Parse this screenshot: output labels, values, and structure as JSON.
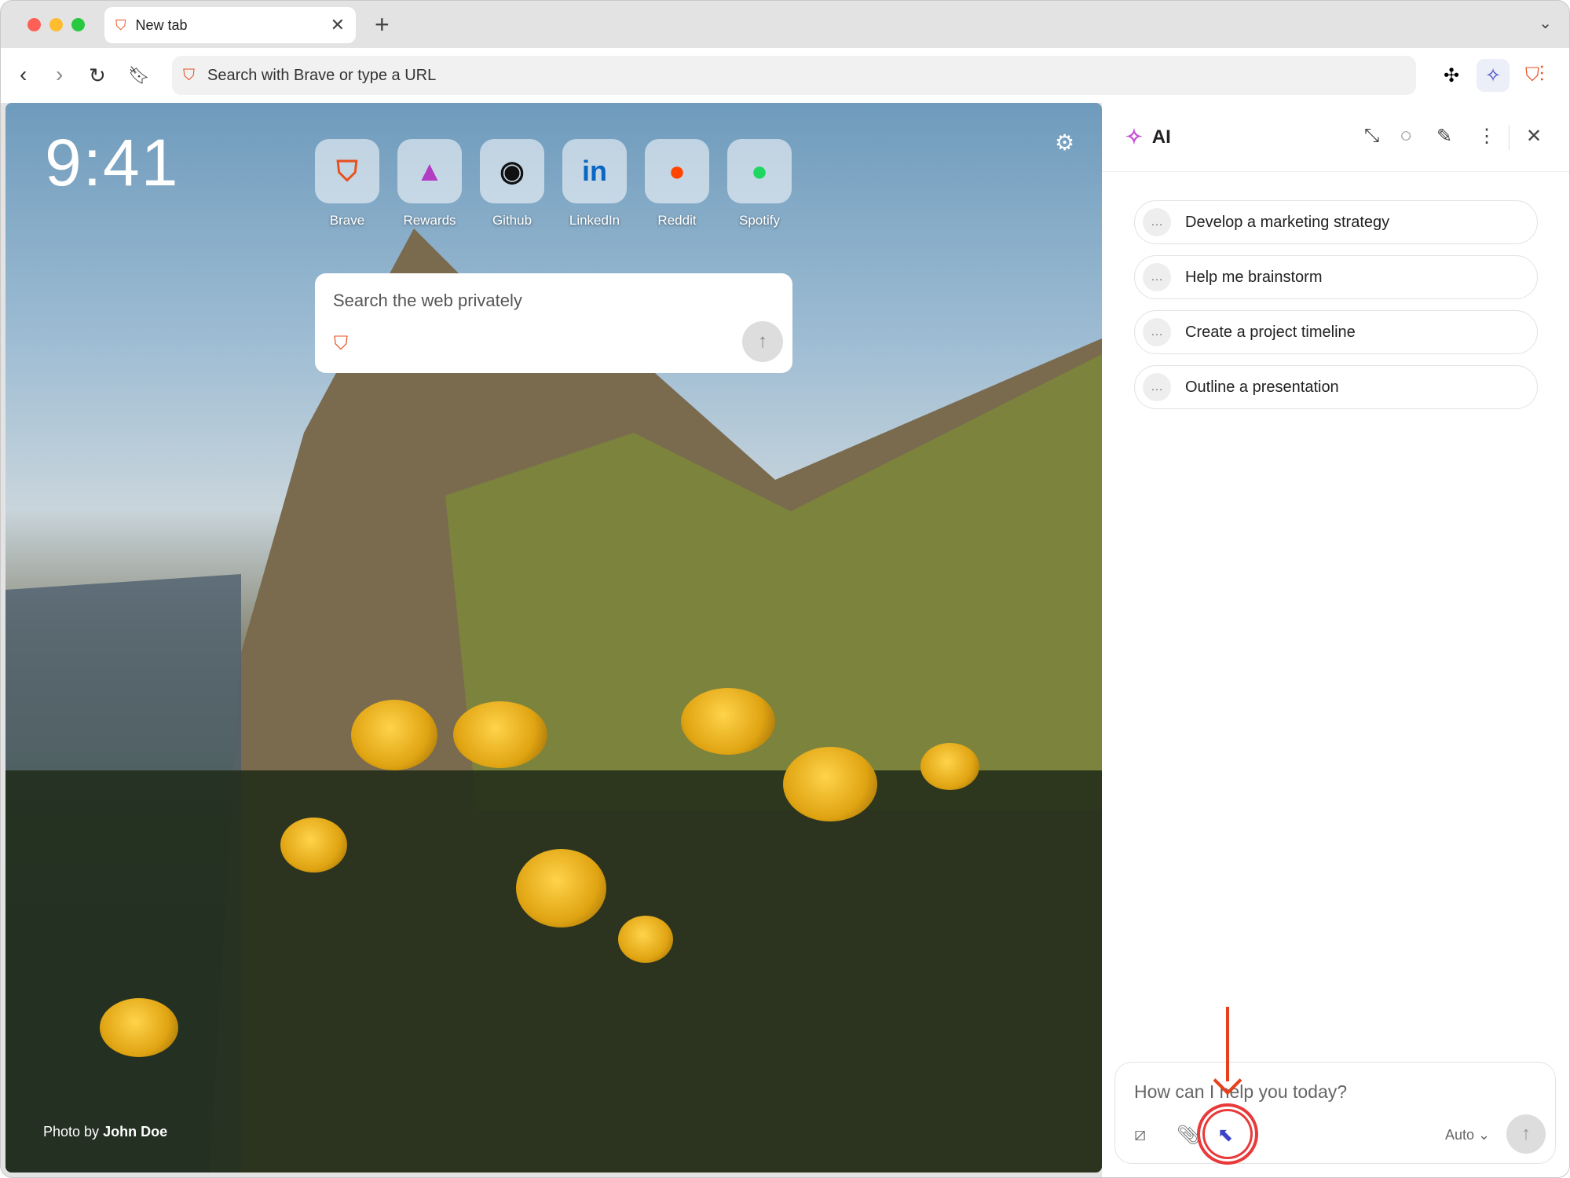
{
  "window": {
    "tab_title": "New tab",
    "traffic_colors": [
      "#fe5f57",
      "#febc2e",
      "#28c840"
    ]
  },
  "toolbar": {
    "omnibox_placeholder": "Search with Brave or type a URL"
  },
  "newtab": {
    "clock": "9:41",
    "shortcuts": [
      {
        "label": "Brave",
        "icon": "brave-icon",
        "glyph": "🦁",
        "color": "#e8501f"
      },
      {
        "label": "Rewards",
        "icon": "rewards-icon",
        "glyph": "▲",
        "color": "#b23cc4"
      },
      {
        "label": "Github",
        "icon": "github-icon",
        "glyph": "◉",
        "color": "#111"
      },
      {
        "label": "LinkedIn",
        "icon": "linkedin-icon",
        "glyph": "in",
        "color": "#0a66c2"
      },
      {
        "label": "Reddit",
        "icon": "reddit-icon",
        "glyph": "●",
        "color": "#ff4500"
      },
      {
        "label": "Spotify",
        "icon": "spotify-icon",
        "glyph": "●",
        "color": "#1ed760"
      }
    ],
    "search_placeholder": "Search the web privately",
    "credit_prefix": "Photo by",
    "credit_name": "John Doe"
  },
  "ai_panel": {
    "title": "AI",
    "suggestions": [
      "Develop a marketing strategy",
      "Help me brainstorm",
      "Create a project timeline",
      "Outline a presentation"
    ],
    "input_placeholder": "How can I help you today?",
    "model": "Auto",
    "accent": "#3b44c4",
    "annotation_color": "#e8401c"
  }
}
